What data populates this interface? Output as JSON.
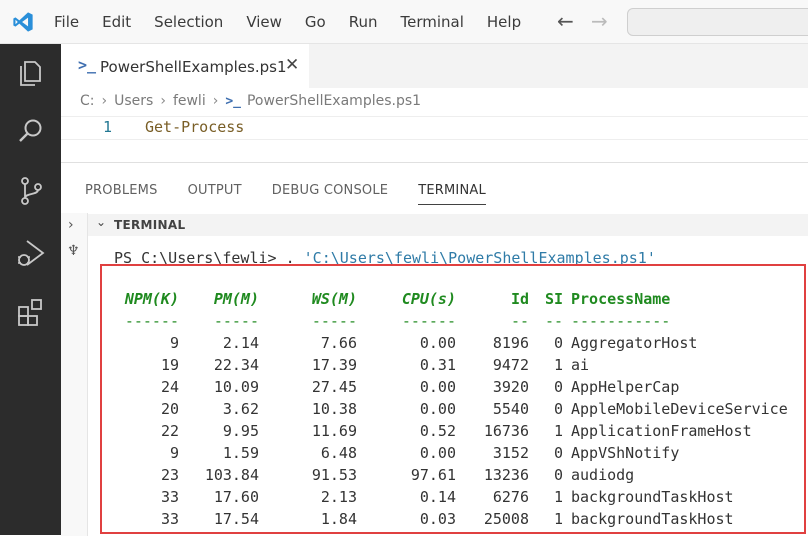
{
  "menu": [
    "File",
    "Edit",
    "Selection",
    "View",
    "Go",
    "Run",
    "Terminal",
    "Help"
  ],
  "editor": {
    "tab_label": "PowerShellExamples.ps1",
    "breadcrumb": [
      "C:",
      "Users",
      "fewli",
      "PowerShellExamples.ps1"
    ],
    "line_number": "1",
    "code": "Get-Process"
  },
  "panel": {
    "tabs": [
      "PROBLEMS",
      "OUTPUT",
      "DEBUG CONSOLE",
      "TERMINAL"
    ],
    "active_tab": "TERMINAL",
    "terminal_title": "TERMINAL"
  },
  "terminal": {
    "prompt": "PS C:\\Users\\fewli> ",
    "prompt_command": ". ",
    "prompt_path": "'C:\\Users\\fewli\\PowerShellExamples.ps1'",
    "headers": [
      "NPM(K)",
      "PM(M)",
      "WS(M)",
      "CPU(s)",
      "Id",
      "SI",
      "ProcessName"
    ],
    "dashes": [
      "------",
      "-----",
      "-----",
      "------",
      "--",
      "--",
      "-----------"
    ],
    "rows": [
      [
        "9",
        "2.14",
        "7.66",
        "0.00",
        "8196",
        "0",
        "AggregatorHost"
      ],
      [
        "19",
        "22.34",
        "17.39",
        "0.31",
        "9472",
        "1",
        "ai"
      ],
      [
        "24",
        "10.09",
        "27.45",
        "0.00",
        "3920",
        "0",
        "AppHelperCap"
      ],
      [
        "20",
        "3.62",
        "10.38",
        "0.00",
        "5540",
        "0",
        "AppleMobileDeviceService"
      ],
      [
        "22",
        "9.95",
        "11.69",
        "0.52",
        "16736",
        "1",
        "ApplicationFrameHost"
      ],
      [
        "9",
        "1.59",
        "6.48",
        "0.00",
        "3152",
        "0",
        "AppVShNotify"
      ],
      [
        "23",
        "103.84",
        "91.53",
        "97.61",
        "13236",
        "0",
        "audiodg"
      ],
      [
        "33",
        "17.60",
        "2.13",
        "0.14",
        "6276",
        "1",
        "backgroundTaskHost"
      ],
      [
        "33",
        "17.54",
        "1.84",
        "0.03",
        "25008",
        "1",
        "backgroundTaskHost"
      ]
    ]
  },
  "colors": {
    "accent": "#007acc",
    "header_green": "#1f8a1f",
    "highlight_red": "#e04040",
    "activity_bar": "#2c2c2c"
  },
  "icons": [
    "vscode-logo-icon",
    "back-arrow-icon",
    "forward-arrow-icon",
    "explorer-icon",
    "search-icon",
    "source-control-icon",
    "run-debug-icon",
    "extensions-icon",
    "powershell-icon",
    "close-icon",
    "chevron-right-icon",
    "chevron-down-icon",
    "plug-icon"
  ]
}
